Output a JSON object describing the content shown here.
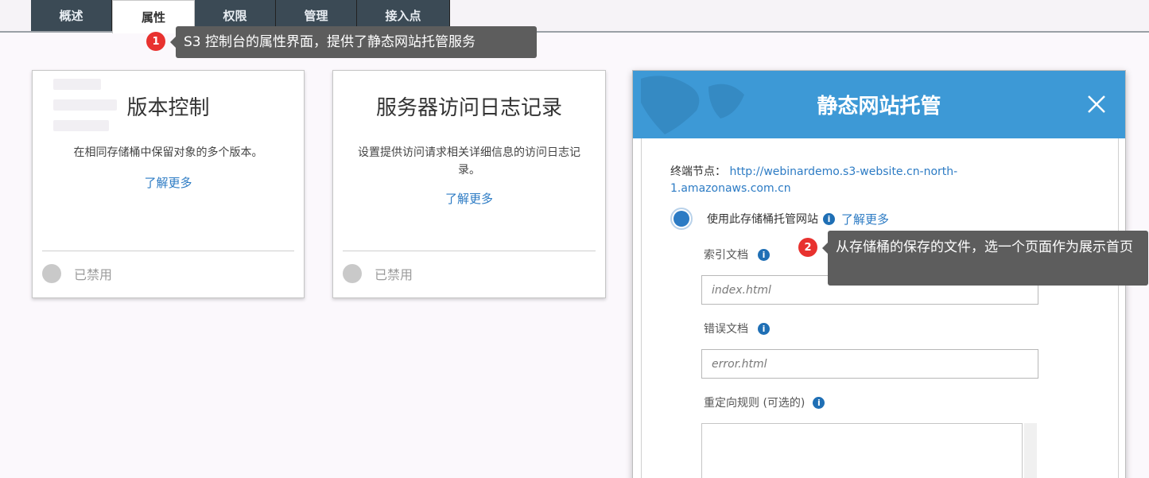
{
  "tabs": [
    {
      "label": "概述"
    },
    {
      "label": "属性"
    },
    {
      "label": "权限"
    },
    {
      "label": "管理"
    },
    {
      "label": "接入点"
    }
  ],
  "active_tab": "属性",
  "callouts": [
    {
      "number": "1",
      "text": "S3 控制台的属性界面，提供了静态网站托管服务"
    },
    {
      "number": "2",
      "text": "从存储桶的保存的文件，选一个页面作为展示首页"
    }
  ],
  "cards": [
    {
      "title": "版本控制",
      "description": "在相同存储桶中保留对象的多个版本。",
      "link": "了解更多",
      "status": "已禁用"
    },
    {
      "title": "服务器访问日志记录",
      "description": "设置提供访问请求相关详细信息的访问日志记录。",
      "link": "了解更多",
      "status": "已禁用"
    }
  ],
  "modal": {
    "title": "静态网站托管",
    "endpoint_label": "终端节点：",
    "endpoint_url": "http://webinardemo.s3-website.cn-north-1.amazonaws.com.cn",
    "radio_label": "使用此存储桶托管网站",
    "learn_more": "了解更多",
    "index_label": "索引文档",
    "index_placeholder": "index.html",
    "error_label": "错误文档",
    "error_placeholder": "error.html",
    "redirect_label": "重定向规则 (可选的)"
  },
  "colors": {
    "header_blue": "#3d99d6",
    "link_blue": "#2c7bc4",
    "tab_dark": "#3b4a55",
    "badge_red": "#e8322f",
    "callout_gray": "#5d5d5d"
  }
}
